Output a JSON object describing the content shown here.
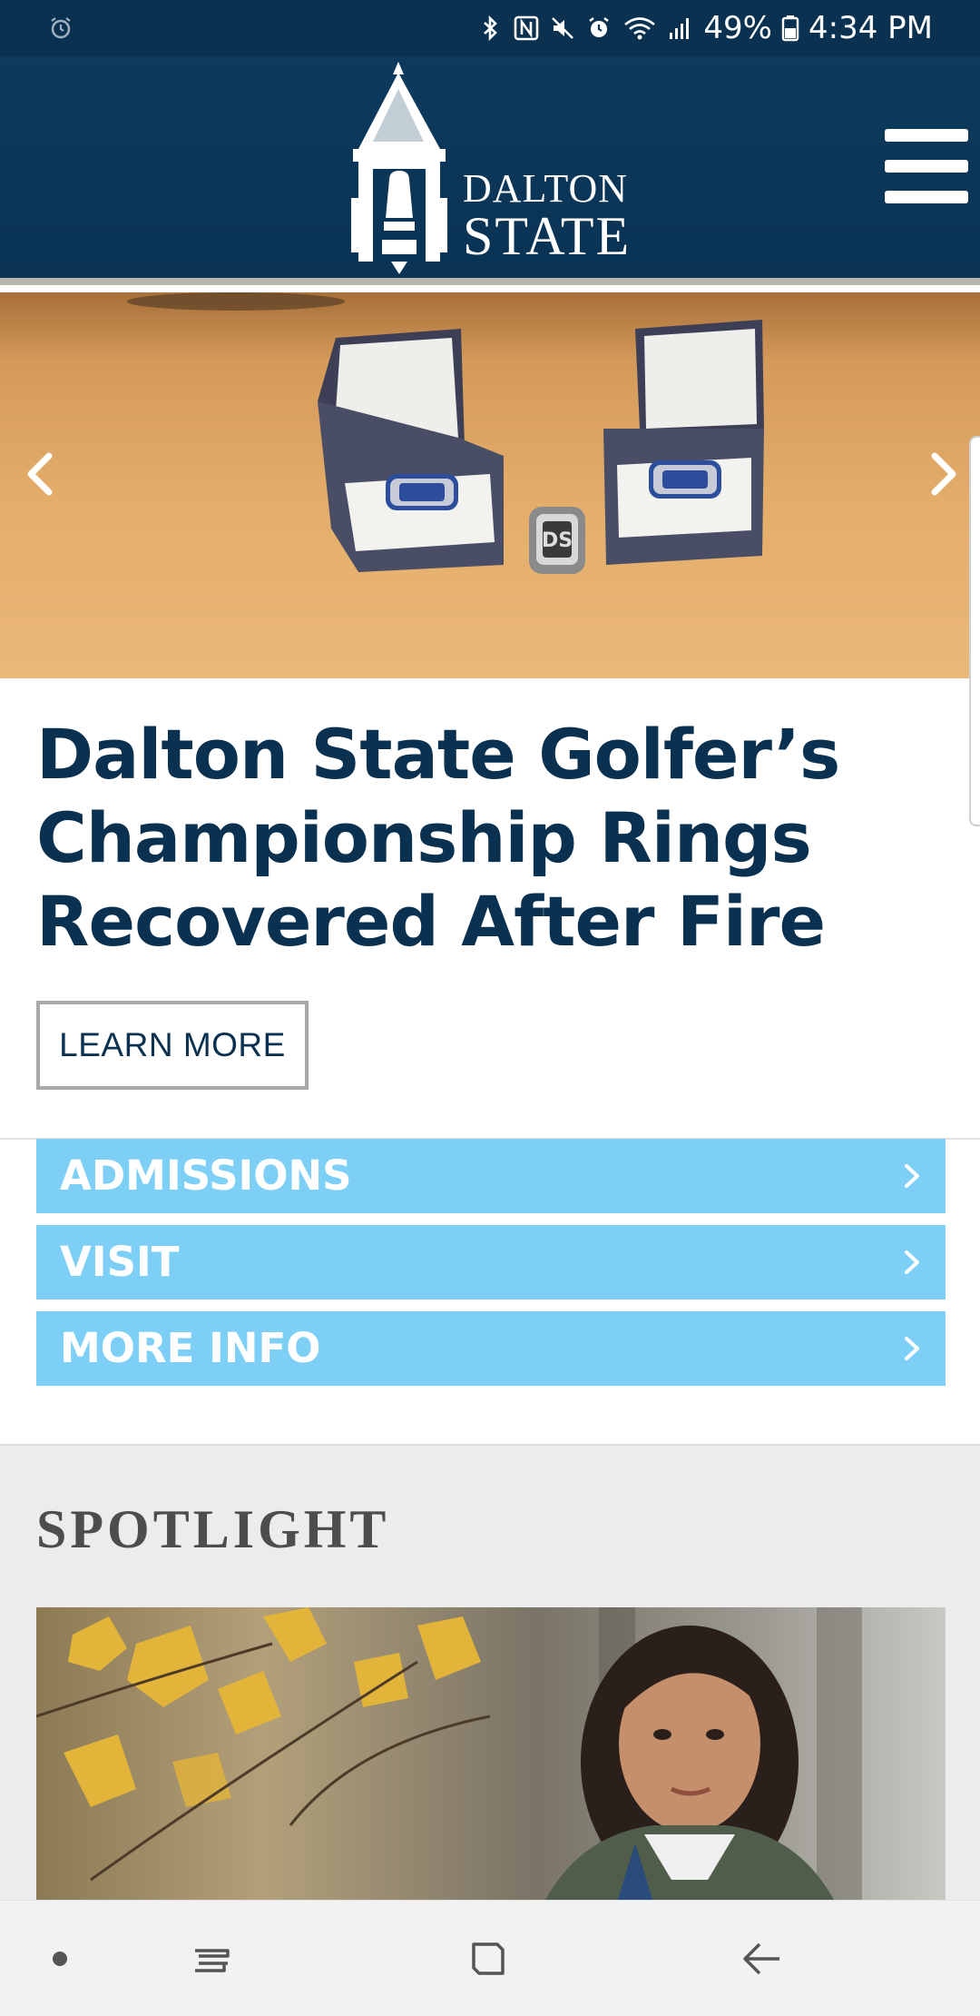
{
  "status_bar": {
    "battery": "49%",
    "time": "4:34 PM",
    "icons": [
      "alarm-icon",
      "bluetooth-icon",
      "nfc-icon",
      "mute-icon",
      "alarm-icon",
      "wifi-icon",
      "signal-icon",
      "battery-icon"
    ]
  },
  "header": {
    "logo_line1": "DALTON",
    "logo_line2": "STATE",
    "brand_color": "#0b3150"
  },
  "hero": {
    "headline": "Dalton State Golfer’s Championship Rings Recovered After Fire",
    "cta_label": "LEARN MORE"
  },
  "quick_links": [
    {
      "label": "ADMISSIONS"
    },
    {
      "label": "VISIT"
    },
    {
      "label": "MORE INFO"
    }
  ],
  "quick_link_color": "#7dcff5",
  "spotlight": {
    "title": "SPOTLIGHT"
  }
}
